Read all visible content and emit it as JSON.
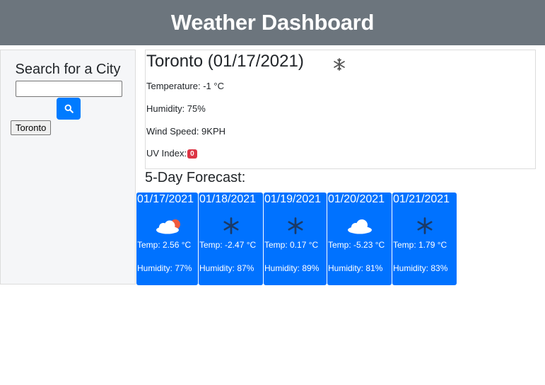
{
  "header": {
    "title": "Weather Dashboard"
  },
  "sidebar": {
    "title": "Search for a City",
    "search_value": "",
    "search_icon": "search-icon",
    "history": [
      "Toronto"
    ]
  },
  "current": {
    "title": "Toronto (01/17/2021)",
    "icon": "snowflake-icon",
    "temperature": "Temperature: -1 °C",
    "humidity": "Humidity: 75%",
    "wind": "Wind Speed: 9KPH",
    "uv_label": "UV Index:",
    "uv_value": "0",
    "uv_color": "#dc3545"
  },
  "forecast": {
    "title": "5-Day Forecast:",
    "card_color": "#0072ff",
    "days": [
      {
        "date": "01/17/2021",
        "icon": "cloudy-sun-icon",
        "temp": "Temp: 2.56 °C",
        "humidity": "Humidity: 77%"
      },
      {
        "date": "01/18/2021",
        "icon": "snowflake-icon",
        "temp": "Temp: -2.47 °C",
        "humidity": "Humidity: 87%"
      },
      {
        "date": "01/19/2021",
        "icon": "snowflake-icon",
        "temp": "Temp: 0.17 °C",
        "humidity": "Humidity: 89%"
      },
      {
        "date": "01/20/2021",
        "icon": "cloud-icon",
        "temp": "Temp: -5.23 °C",
        "humidity": "Humidity: 81%"
      },
      {
        "date": "01/21/2021",
        "icon": "snowflake-icon",
        "temp": "Temp: 1.79 °C",
        "humidity": "Humidity: 83%"
      }
    ]
  }
}
